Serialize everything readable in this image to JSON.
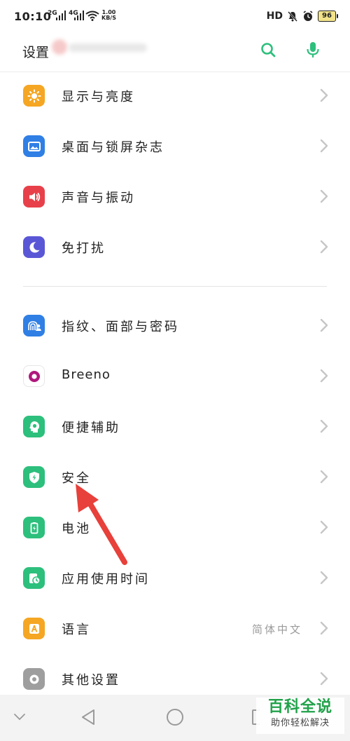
{
  "status_bar": {
    "time": "10:10",
    "sim1": "2G",
    "sim2": "4G",
    "speed_value": "1.00",
    "speed_unit": "KB/S",
    "hd": "HD",
    "battery": "96"
  },
  "header": {
    "title": "设置"
  },
  "settings_items": [
    {
      "label": "显示与亮度",
      "icon": "brightness-icon",
      "color": "#F5A623"
    },
    {
      "label": "桌面与锁屏杂志",
      "icon": "wallpaper-icon",
      "color": "#2F7FE5"
    },
    {
      "label": "声音与振动",
      "icon": "speaker-icon",
      "color": "#E8404A"
    },
    {
      "label": "免打扰",
      "icon": "moon-icon",
      "color": "#5A57D6"
    },
    {
      "label": "指纹、面部与密码",
      "icon": "fingerprint-face-icon",
      "color": "#2F7FE5"
    },
    {
      "label": "Breeno",
      "icon": "breeno-icon",
      "color": "#B0187C"
    },
    {
      "label": "便捷辅助",
      "icon": "assist-icon",
      "color": "#2DBF7C"
    },
    {
      "label": "安全",
      "icon": "shield-icon",
      "color": "#2DBF7C"
    },
    {
      "label": "电池",
      "icon": "battery-icon",
      "color": "#2DBF7C"
    },
    {
      "label": "应用使用时间",
      "icon": "app-time-icon",
      "color": "#2DBF7C"
    },
    {
      "label": "语言",
      "icon": "language-icon",
      "color": "#F5A623",
      "value": "简体中文"
    },
    {
      "label": "其他设置",
      "icon": "gear-icon",
      "color": "#9E9E9E"
    }
  ],
  "colors": {
    "accent": "#2DBF7C",
    "arrow": "#E8403A",
    "watermark_green": "#21A24A"
  },
  "watermark": {
    "title": "百科全说",
    "subtitle": "助你轻松解决"
  }
}
